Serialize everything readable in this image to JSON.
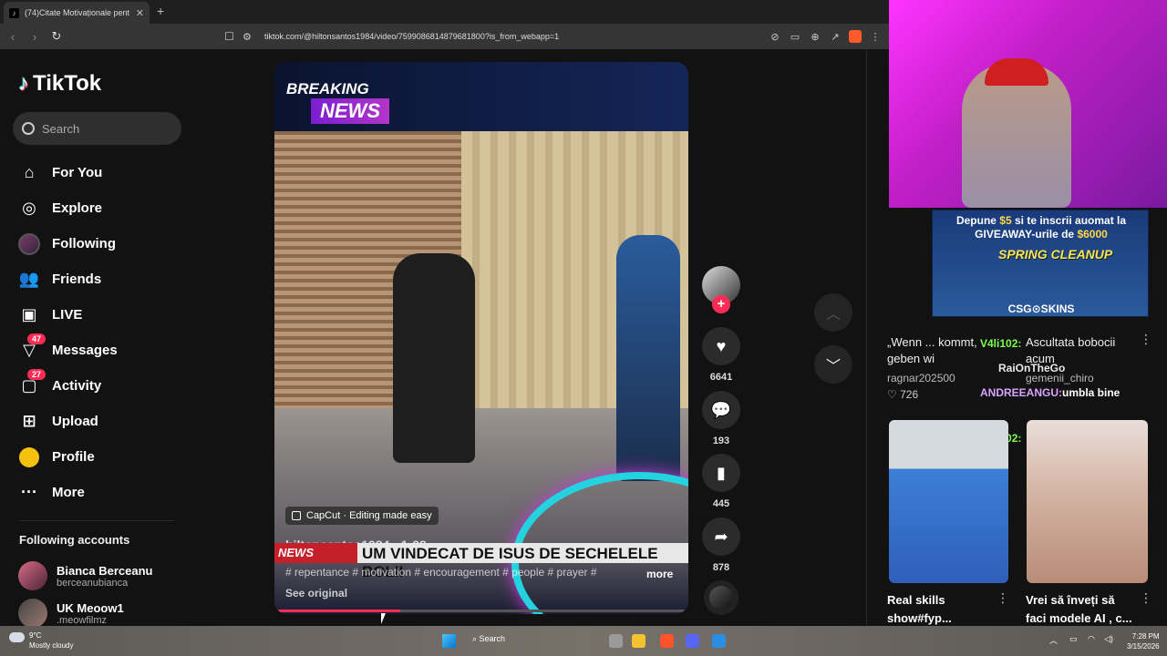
{
  "browser": {
    "tab_title": "(74)Citate Motivaționale pent",
    "tab_close": "✕",
    "new_tab": "+",
    "url": "tiktok.com/@hiltonsantos1984/video/7599086814879681800?is_from_webapp=1"
  },
  "sidebar": {
    "logo": "TikTok",
    "search_placeholder": "Search",
    "items": [
      {
        "label": "For You",
        "icon": "home-icon"
      },
      {
        "label": "Explore",
        "icon": "compass-icon"
      },
      {
        "label": "Following",
        "icon": "following-avatar-icon"
      },
      {
        "label": "Friends",
        "icon": "friends-icon"
      },
      {
        "label": "LIVE",
        "icon": "live-tv-icon"
      },
      {
        "label": "Messages",
        "icon": "messages-icon",
        "badge": "47"
      },
      {
        "label": "Activity",
        "icon": "activity-icon",
        "badge": "27"
      },
      {
        "label": "Upload",
        "icon": "upload-icon"
      },
      {
        "label": "Profile",
        "icon": "profile-icon"
      },
      {
        "label": "More",
        "icon": "more-icon"
      }
    ],
    "following_title": "Following accounts",
    "accounts": [
      {
        "name": "Bianca Berceanu",
        "handle": "berceanubianca"
      },
      {
        "name": "UK Meoow1",
        "handle": ".meowfilmz"
      }
    ]
  },
  "video": {
    "banner_top": "BREAKING",
    "banner_bottom": "NEWS",
    "capcut": "CapCut · Editing made easy",
    "author": "hiltonsantos1984 · 1-28",
    "lower_tag": "NEWS",
    "headline": "UM VINDECAT DE ISUS DE SECHELELE BOLII",
    "caption": "# repentance # motivation # encouragement # people # prayer #",
    "more": "more",
    "see_original": "See original",
    "progress": 0.3
  },
  "actions": {
    "likes": "6641",
    "comments": "193",
    "saves": "445",
    "shares": "878"
  },
  "stream": {
    "ad_line1_prefix": "Depune ",
    "ad_line1_amount": "$5",
    "ad_line1_suffix": " si te inscrii auomat la",
    "ad_line2_prefix": "GIVEAWAY-urile de ",
    "ad_line2_amount": "$6000",
    "ad_spring": "SPRING CLEANUP",
    "ad_brand": "CSG⊙SKINS",
    "rec1_title": "„Wenn ... kommt, geben wi",
    "rec1_author": "ragnar202500",
    "rec1_likes": "726",
    "rec2_title": "Ascultata bobocii acum",
    "rec2_author": "gemenii_chiro",
    "chat": [
      {
        "user": "V4li102:",
        "color": "#7CFF4F"
      },
      {
        "user": "RaiOnTheGo",
        "color": "#e8e8e8"
      },
      {
        "user": "ANDREEANGU:",
        "color": "#d7a4ff",
        "msg": "umbla bine"
      },
      {
        "user": "V4li102:",
        "color": "#7CFF4F"
      }
    ],
    "vid1_title": "Real skills show#fyp...",
    "vid2_title": "Vrei să înveți să faci modele AI , c..."
  },
  "taskbar": {
    "temp": "9°C",
    "weather": "Mostly cloudy",
    "search": "Search",
    "time": "7:28 PM",
    "date": "3/15/2026"
  }
}
